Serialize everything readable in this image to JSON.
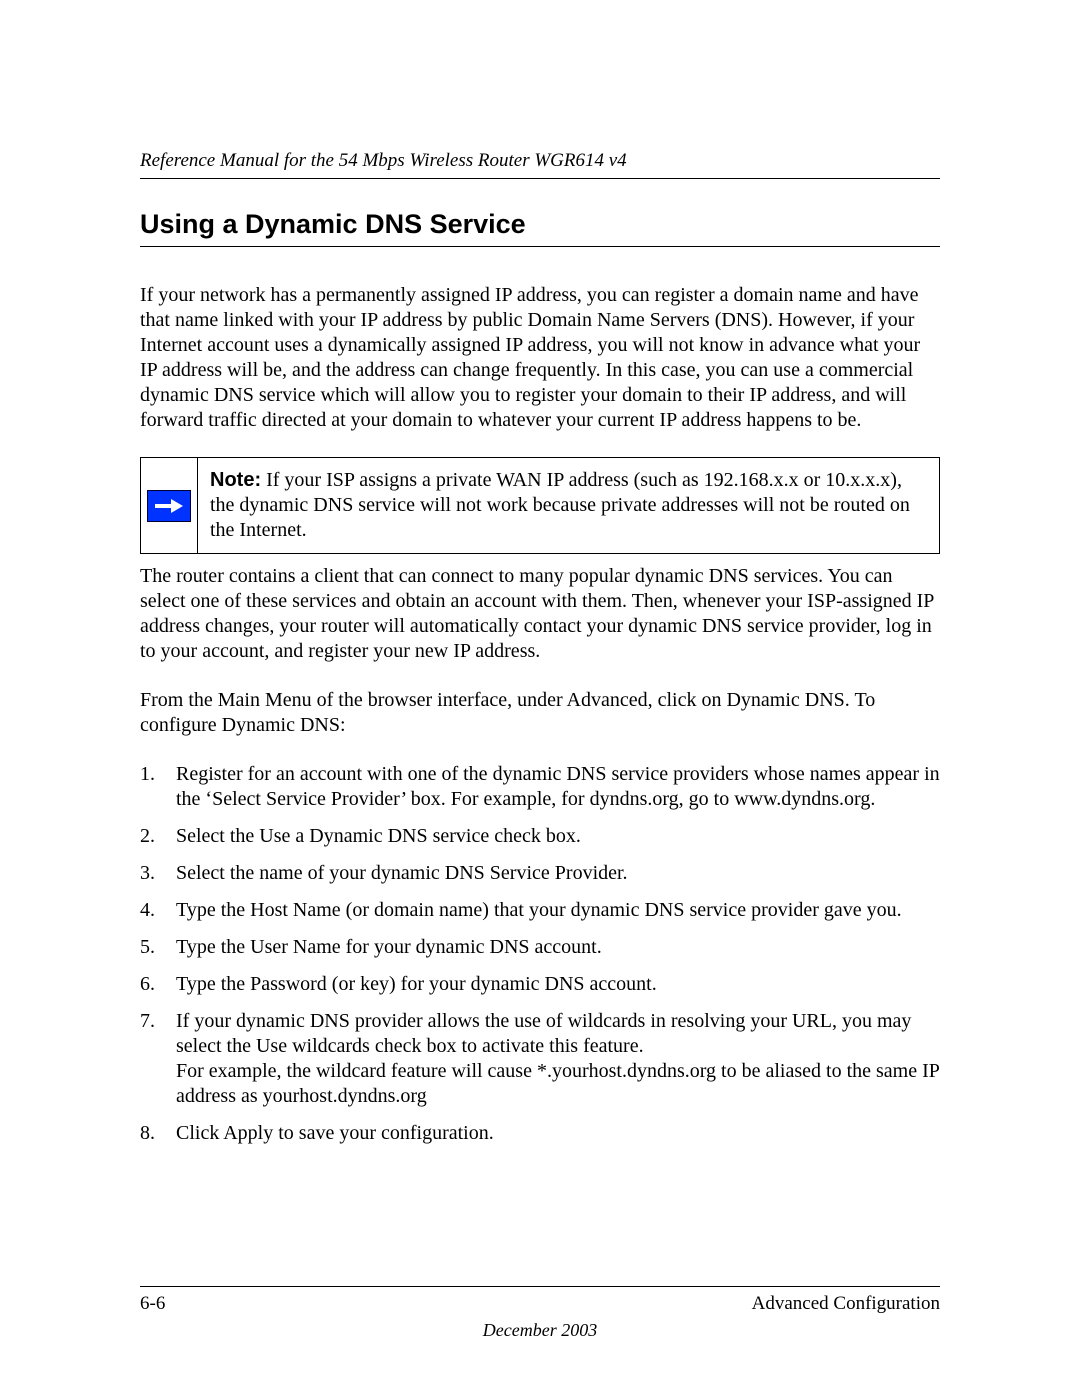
{
  "header": {
    "running_title": "Reference Manual for the 54 Mbps Wireless Router WGR614 v4"
  },
  "section": {
    "title": "Using a Dynamic DNS Service",
    "intro": "If your network has a permanently assigned IP address, you can register a domain name and have that name linked with your IP address by public Domain Name Servers (DNS). However, if your Internet account uses a dynamically assigned IP address, you will not know in advance what your IP address will be, and the address can change frequently. In this case, you can use a commercial dynamic DNS service which will allow you to register your domain to their IP address, and will forward traffic directed at your domain to whatever your current IP address happens to be.",
    "note": {
      "label": "Note:",
      "text": " If your ISP assigns a private WAN IP address (such as 192.168.x.x or 10.x.x.x), the dynamic DNS service will not work because private addresses will not be routed on the Internet."
    },
    "after_note": "The router contains a client that can connect to many popular dynamic DNS services. You can select one of these services and obtain an account with them. Then, whenever your ISP-assigned IP address changes, your router will automatically contact your dynamic DNS service provider, log in to your account, and register your new IP address.",
    "lead_in": "From the Main Menu of the browser interface, under Advanced, click on Dynamic DNS. To configure Dynamic DNS:",
    "steps": [
      "Register for an account with one of the dynamic DNS service providers whose names appear in the ‘Select Service Provider’ box. For example, for dyndns.org, go to www.dyndns.org.",
      "Select the Use a Dynamic DNS service check box.",
      "Select the name of your dynamic DNS Service Provider.",
      "Type the Host Name (or domain name) that your dynamic DNS service provider gave you.",
      "Type the User Name for your dynamic DNS account.",
      "Type the Password (or key) for your dynamic DNS account.",
      "If your dynamic DNS provider allows the use of wildcards in resolving your URL, you may select the Use wildcards check box to activate this feature.\nFor example, the wildcard feature will cause *.yourhost.dyndns.org to be aliased to the same IP address as yourhost.dyndns.org",
      "Click Apply to save your configuration."
    ]
  },
  "footer": {
    "page_number": "6-6",
    "section_name": "Advanced Configuration",
    "date": "December 2003"
  }
}
